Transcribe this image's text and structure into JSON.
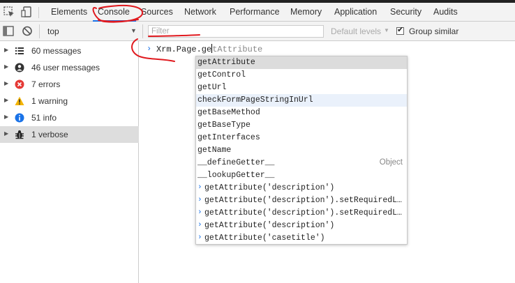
{
  "tabs": {
    "items": [
      {
        "label": "Elements"
      },
      {
        "label": "Console"
      },
      {
        "label": "Sources"
      },
      {
        "label": "Network"
      },
      {
        "label": "Performance"
      },
      {
        "label": "Memory"
      },
      {
        "label": "Application"
      },
      {
        "label": "Security"
      },
      {
        "label": "Audits"
      }
    ],
    "active": "Console",
    "icons": [
      "inspect-element-icon",
      "device-toolbar-icon"
    ]
  },
  "toolbar": {
    "context": "top",
    "filter_placeholder": "Filter",
    "levels_label": "Default levels",
    "group_similar_label": "Group similar",
    "group_similar_checked": true
  },
  "sidebar": {
    "items": [
      {
        "label": "60 messages",
        "icon": "list-icon"
      },
      {
        "label": "46 user messages",
        "icon": "user-icon"
      },
      {
        "label": "7 errors",
        "icon": "error-icon",
        "color": "#e53935"
      },
      {
        "label": "1 warning",
        "icon": "warning-icon",
        "color": "#f4b400"
      },
      {
        "label": "51 info",
        "icon": "info-icon",
        "color": "#1a73e8"
      },
      {
        "label": "1 verbose",
        "icon": "bug-icon",
        "selected": true
      }
    ]
  },
  "console": {
    "prompt": "›",
    "typed": "Xrm.Page.ge",
    "ghost": "tAttribute"
  },
  "autocomplete": {
    "items": [
      {
        "text": "getAttribute",
        "state": "selected"
      },
      {
        "text": "getControl"
      },
      {
        "text": "getUrl"
      },
      {
        "text": "checkFormPageStringInUrl",
        "state": "hover"
      },
      {
        "text": "getBaseMethod"
      },
      {
        "text": "getBaseType"
      },
      {
        "text": "getInterfaces"
      },
      {
        "text": "getName"
      },
      {
        "text": "__defineGetter__",
        "kind": "Object"
      },
      {
        "text": "__lookupGetter__"
      },
      {
        "text": "getAttribute('description')",
        "history": true
      },
      {
        "text": "getAttribute('description').setRequiredLev…",
        "history": true
      },
      {
        "text": "getAttribute('description').setRequiredLev…",
        "history": true
      },
      {
        "text": "getAttribute('description')",
        "history": true
      },
      {
        "text": "getAttribute('casetitle')",
        "history": true
      }
    ]
  },
  "colors": {
    "accent": "#1a73e8",
    "annotation": "#e0191e"
  }
}
